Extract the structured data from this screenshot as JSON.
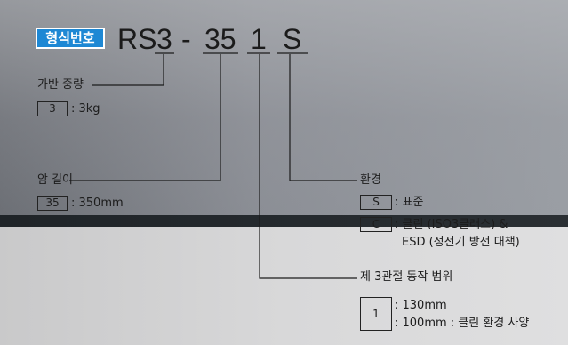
{
  "badge": "형식번호",
  "model": {
    "prefix": "RS",
    "load": "3",
    "dash": "-",
    "arm": "35",
    "range": "1",
    "env": "S"
  },
  "payload": {
    "title": "가반 중량",
    "code": "3",
    "desc": ": 3kg"
  },
  "arm_length": {
    "title": "암 길이",
    "code": "35",
    "desc": ": 350mm"
  },
  "environment": {
    "title": "환경",
    "options": [
      {
        "code": "S",
        "desc": ": 표준"
      },
      {
        "code": "C",
        "desc": ": 클린 (ISO3클래스) &",
        "desc2": "ESD (정전기 방전 대책)"
      }
    ]
  },
  "joint3": {
    "title": "제 3관절 동작 범위",
    "code": "1",
    "desc1": ": 130mm",
    "desc2": ": 100mm : 클린 환경 사양"
  }
}
